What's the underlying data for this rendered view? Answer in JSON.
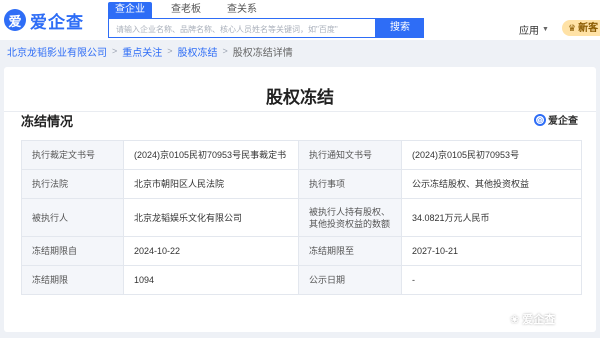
{
  "header": {
    "logo_mark": "爱",
    "logo_text": "爱企查",
    "tabs": [
      {
        "label": "查企业",
        "active": true
      },
      {
        "label": "查老板",
        "active": false
      },
      {
        "label": "查关系",
        "active": false
      }
    ],
    "search": {
      "placeholder": "请输入企业名称、品牌名称、核心人员姓名等关键词，如\"百度\"",
      "button_label": "搜索"
    },
    "apps_label": "应用",
    "new_badge_label": "新客"
  },
  "breadcrumb": {
    "items": [
      "北京龙韬影业有限公司",
      "重点关注",
      "股权冻结"
    ],
    "current": "股权冻结详情"
  },
  "page": {
    "title": "股权冻结",
    "section_title": "冻结情况",
    "watermark": "爱企查"
  },
  "info_table": {
    "rows": [
      {
        "label1": "执行裁定文书号",
        "value1": "(2024)京0105民初70953号民事裁定书",
        "label2": "执行通知文书号",
        "value2": "(2024)京0105民初70953号"
      },
      {
        "label1": "执行法院",
        "value1": "北京市朝阳区人民法院",
        "label2": "执行事项",
        "value2": "公示冻结股权、其他投资权益"
      },
      {
        "label1": "被执行人",
        "value1": "北京龙韬娱乐文化有限公司",
        "label2": "被执行人持有股权、其他投资权益的数额",
        "value2": "34.0821万元人民币"
      },
      {
        "label1": "冻结期限自",
        "value1": "2024-10-22",
        "label2": "冻结期限至",
        "value2": "2027-10-21"
      },
      {
        "label1": "冻结期限",
        "value1": "1094",
        "label2": "公示日期",
        "value2": "-"
      }
    ]
  },
  "footer_watermark": "爱企查",
  "colors": {
    "brand": "#2e6df6",
    "label_bg": "#f4f6fa",
    "page_bg": "#eef1f6"
  }
}
